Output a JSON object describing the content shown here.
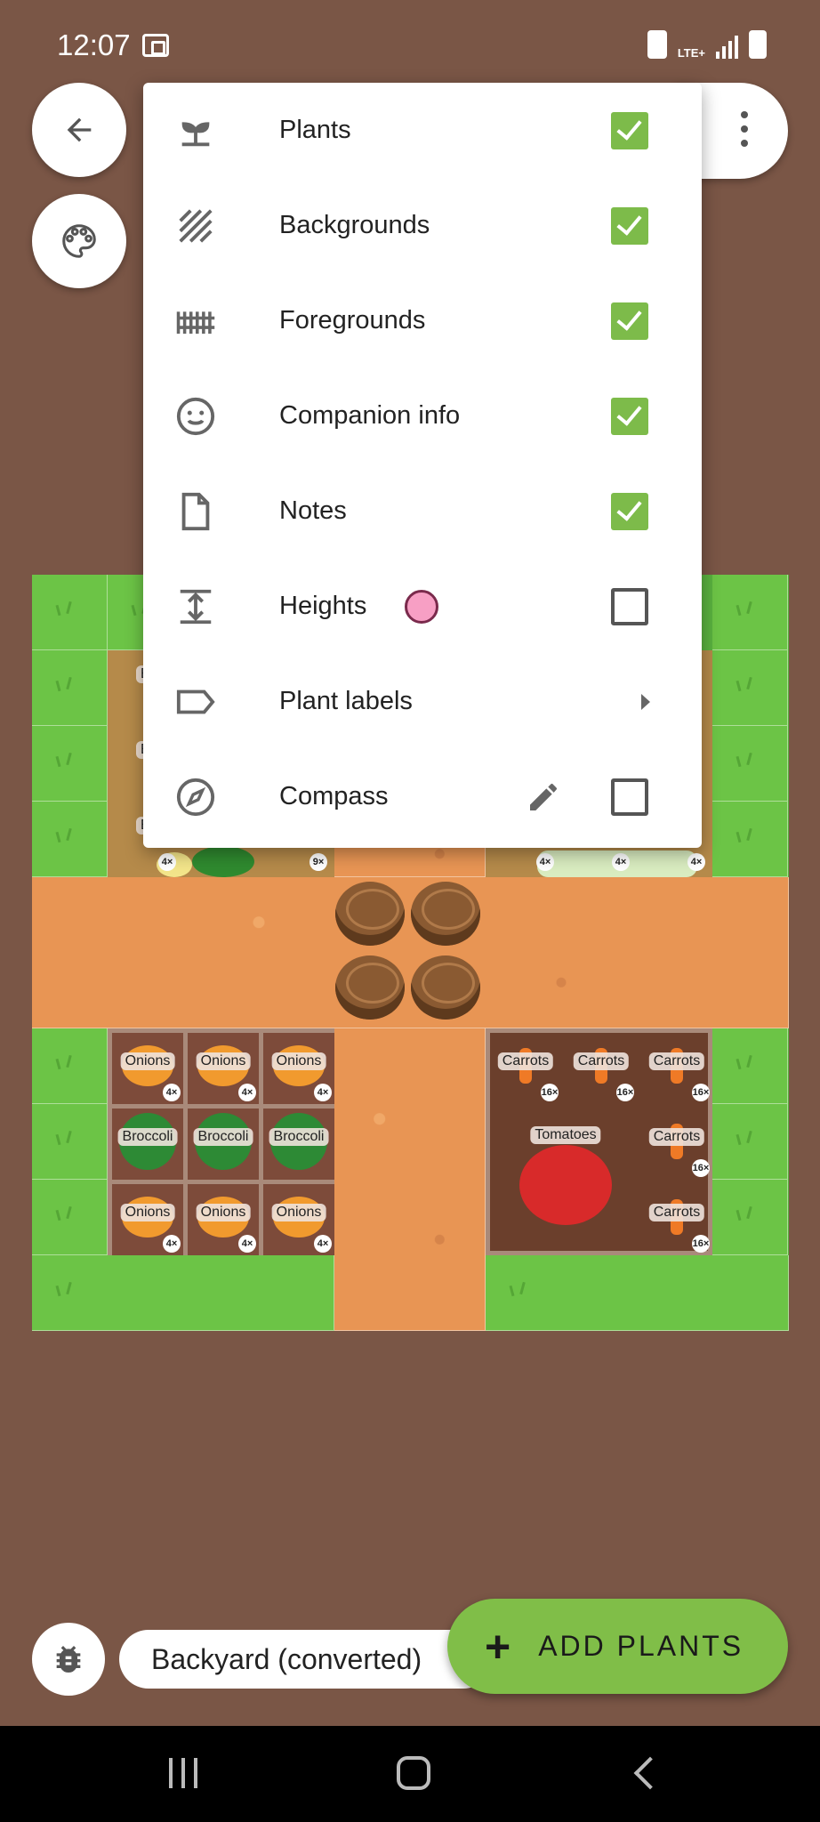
{
  "status_bar": {
    "time": "12:07",
    "network": "LTE+"
  },
  "toolbar": {
    "back_icon": "arrow-left-icon",
    "palette_icon": "palette-icon",
    "more_icon": "more-vert-icon"
  },
  "layers_menu": {
    "items": [
      {
        "label": "Plants",
        "icon": "sprout-icon",
        "checked": true
      },
      {
        "label": "Backgrounds",
        "icon": "hatch-icon",
        "checked": true
      },
      {
        "label": "Foregrounds",
        "icon": "fence-icon",
        "checked": true
      },
      {
        "label": "Companion info",
        "icon": "smiley-icon",
        "checked": true
      },
      {
        "label": "Notes",
        "icon": "note-icon",
        "checked": true
      },
      {
        "label": "Heights",
        "icon": "height-icon",
        "checked": false,
        "indicator_color": "#f79fc4"
      },
      {
        "label": "Plant labels",
        "icon": "label-icon",
        "submenu": true
      },
      {
        "label": "Compass",
        "icon": "compass-icon",
        "checked": false,
        "edit_icon": "pencil-icon"
      }
    ]
  },
  "garden": {
    "partial_labels": [
      "Bea",
      "Bea",
      "Bea"
    ],
    "counts_top_row": [
      "4×",
      "9×",
      "4×",
      "4×",
      "4×"
    ],
    "plants": [
      {
        "label": "Onions",
        "count": "4×"
      },
      {
        "label": "Onions",
        "count": "4×"
      },
      {
        "label": "Onions",
        "count": "4×"
      },
      {
        "label": "Broccoli"
      },
      {
        "label": "Broccoli"
      },
      {
        "label": "Broccoli"
      },
      {
        "label": "Onions",
        "count": "4×"
      },
      {
        "label": "Onions",
        "count": "4×"
      },
      {
        "label": "Onions",
        "count": "4×"
      },
      {
        "label": "Carrots",
        "count": "16×"
      },
      {
        "label": "Carrots",
        "count": "16×"
      },
      {
        "label": "Carrots",
        "count": "16×"
      },
      {
        "label": "Carrots",
        "count": "16×"
      },
      {
        "label": "Tomatoes"
      },
      {
        "label": "Carrots",
        "count": "16×"
      }
    ]
  },
  "bottom": {
    "bug_icon": "bug-icon",
    "garden_name": "Backyard (converted)",
    "add_plants_label": "ADD PLANTS",
    "add_icon": "plus-icon"
  },
  "colors": {
    "background": "#7a5646",
    "accent": "#80be48",
    "checkbox_on": "#7dbb4a"
  }
}
